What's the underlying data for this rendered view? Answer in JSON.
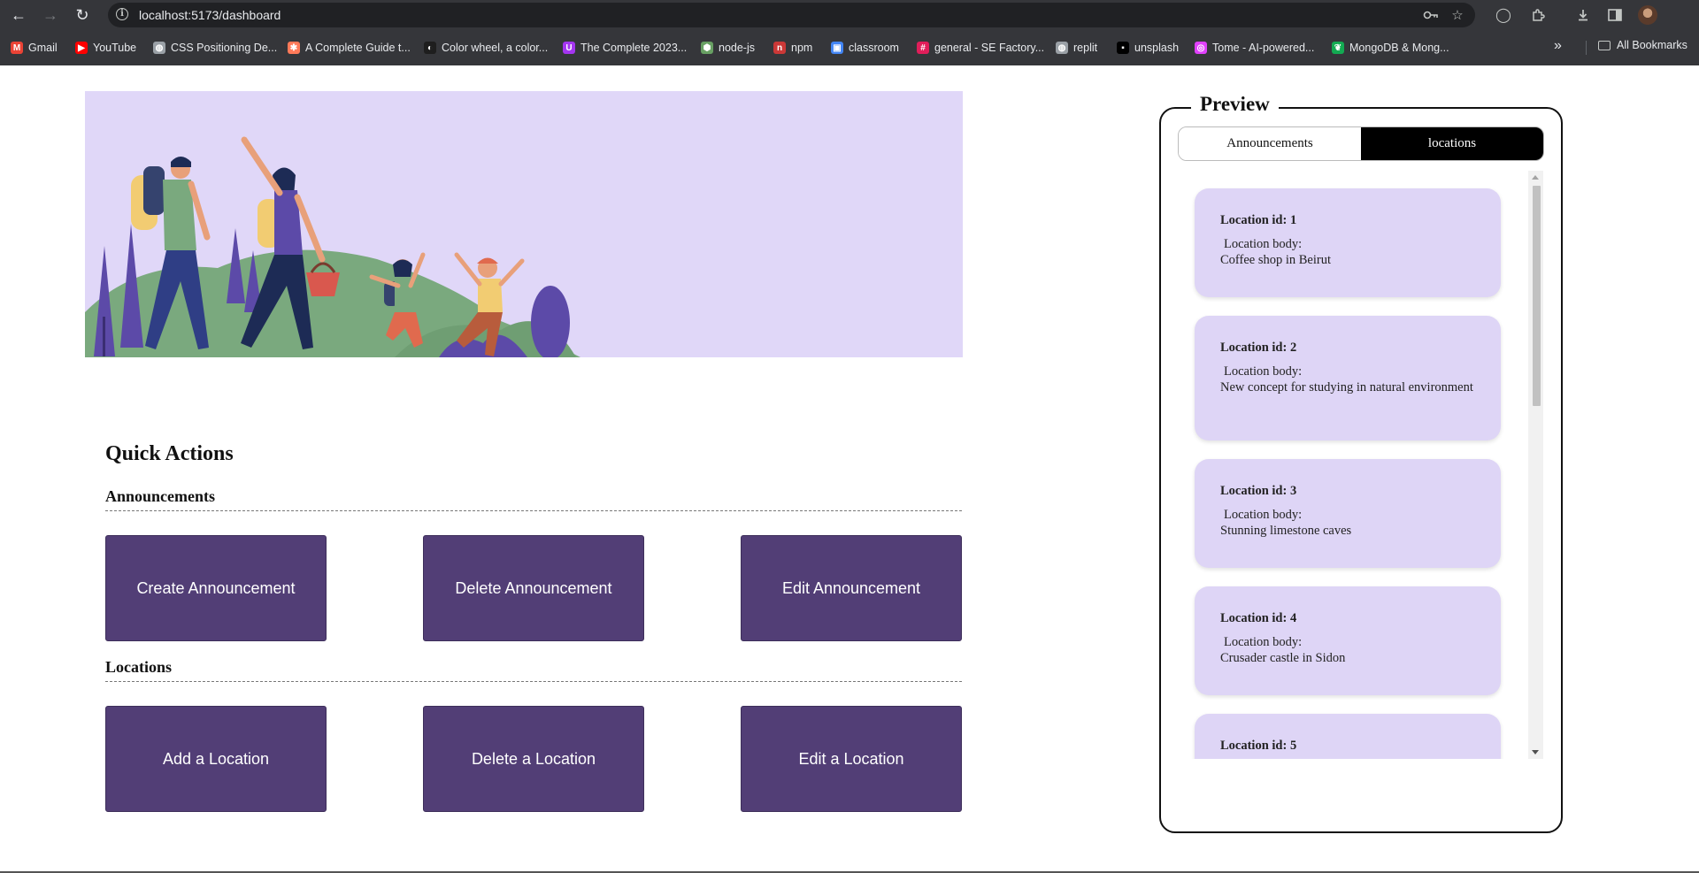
{
  "browser": {
    "url": "localhost:5173/dashboard",
    "bookmarks": [
      {
        "label": "Gmail",
        "icon": "gmail-icon",
        "color": "#ea4335"
      },
      {
        "label": "YouTube",
        "icon": "youtube-icon",
        "color": "#ff0000"
      },
      {
        "label": "CSS Positioning De...",
        "icon": "globe-icon",
        "color": "#9aa0a6"
      },
      {
        "label": "A Complete Guide t...",
        "icon": "asterisk-icon",
        "color": "#ff7a59"
      },
      {
        "label": "Color wheel, a color...",
        "icon": "adobe-color-icon",
        "color": "#1e1e1e"
      },
      {
        "label": "The Complete 2023...",
        "icon": "udemy-icon",
        "color": "#a435f0"
      },
      {
        "label": "node-js",
        "icon": "nodejs-icon",
        "color": "#68a063"
      },
      {
        "label": "npm",
        "icon": "npm-icon",
        "color": "#cb3837"
      },
      {
        "label": "classroom",
        "icon": "classroom-icon",
        "color": "#4285f4"
      },
      {
        "label": "general - SE Factory...",
        "icon": "slack-icon",
        "color": "#e01e5a"
      },
      {
        "label": "replit",
        "icon": "globe-icon",
        "color": "#9aa0a6"
      },
      {
        "label": "unsplash",
        "icon": "unsplash-icon",
        "color": "#000000"
      },
      {
        "label": "Tome - AI-powered...",
        "icon": "tome-icon",
        "color": "#e040fb"
      },
      {
        "label": "MongoDB & Mong...",
        "icon": "mongodb-icon",
        "color": "#13aa52"
      }
    ],
    "all_bookmarks_label": "All Bookmarks",
    "overflow_glyph": "»"
  },
  "hero": {
    "background": "#e0d7f8",
    "image_name": "family-hiking-illustration"
  },
  "quick_actions": {
    "title": "Quick Actions",
    "announcements_heading": "Announcements",
    "locations_heading": "Locations",
    "announcement_buttons": [
      "Create Announcement",
      "Delete Announcement",
      "Edit Announcement"
    ],
    "location_buttons": [
      "Add a Location",
      "Delete a Location",
      "Edit a Location"
    ],
    "button_color": "#523e76"
  },
  "preview": {
    "title": "Preview",
    "tabs": [
      {
        "label": "Announcements",
        "active": false
      },
      {
        "label": "locations",
        "active": true
      }
    ],
    "body_label": "Location body:",
    "items": [
      {
        "id_label": "Location id: 1",
        "body": "Coffee shop in Beirut"
      },
      {
        "id_label": "Location id: 2",
        "body": "New concept for studying in natural environment"
      },
      {
        "id_label": "Location id: 3",
        "body": "Stunning limestone caves"
      },
      {
        "id_label": "Location id: 4",
        "body": "Crusader castle in Sidon"
      },
      {
        "id_label": "Location id: 5",
        "body": ""
      }
    ],
    "card_color": "#ded5f6"
  }
}
